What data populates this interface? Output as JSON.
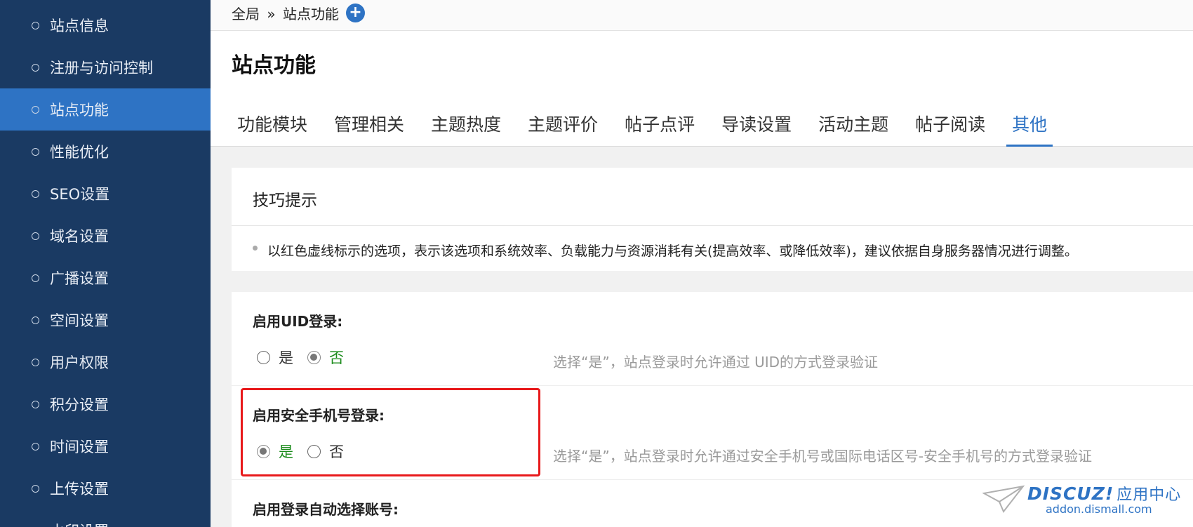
{
  "sidebar": {
    "items": [
      {
        "label": "站点信息",
        "active": false
      },
      {
        "label": "注册与访问控制",
        "active": false
      },
      {
        "label": "站点功能",
        "active": true
      },
      {
        "label": "性能优化",
        "active": false
      },
      {
        "label": "SEO设置",
        "active": false
      },
      {
        "label": "域名设置",
        "active": false
      },
      {
        "label": "广播设置",
        "active": false
      },
      {
        "label": "空间设置",
        "active": false
      },
      {
        "label": "用户权限",
        "active": false
      },
      {
        "label": "积分设置",
        "active": false
      },
      {
        "label": "时间设置",
        "active": false
      },
      {
        "label": "上传设置",
        "active": false
      },
      {
        "label": "水印设置",
        "active": false
      }
    ]
  },
  "breadcrumb": {
    "root": "全局",
    "separator": "»",
    "current": "站点功能",
    "add_icon": "plus-icon"
  },
  "page": {
    "title": "站点功能",
    "tabs": [
      {
        "label": "功能模块",
        "active": false
      },
      {
        "label": "管理相关",
        "active": false
      },
      {
        "label": "主题热度",
        "active": false
      },
      {
        "label": "主题评价",
        "active": false
      },
      {
        "label": "帖子点评",
        "active": false
      },
      {
        "label": "导读设置",
        "active": false
      },
      {
        "label": "活动主题",
        "active": false
      },
      {
        "label": "帖子阅读",
        "active": false
      },
      {
        "label": "其他",
        "active": true
      }
    ]
  },
  "tips": {
    "title": "技巧提示",
    "text": "以红色虚线标示的选项，表示该选项和系统效率、负载能力与资源消耗有关(提高效率、或降低效率)，建议依据自身服务器情况进行调整。"
  },
  "settings": [
    {
      "label": "启用UID登录:",
      "yes": "是",
      "no": "否",
      "selected": "no",
      "description": "选择“是”，站点登录时允许通过 UID的方式登录验证"
    },
    {
      "label": "启用安全手机号登录:",
      "yes": "是",
      "no": "否",
      "selected": "yes",
      "description": "选择“是”，站点登录时允许通过安全手机号或国际电话区号-安全手机号的方式登录验证"
    },
    {
      "label": "启用登录自动选择账号:"
    }
  ],
  "watermark": {
    "brand": "DISCUZ!",
    "brand_cn": "应用中心",
    "url": "addon.dismall.com"
  },
  "colors": {
    "sidebar_bg": "#1a3a63",
    "sidebar_active": "#2e73c4",
    "accent": "#2e73c4",
    "selected_green": "#1a8a1a",
    "highlight_red": "#e8191b"
  }
}
